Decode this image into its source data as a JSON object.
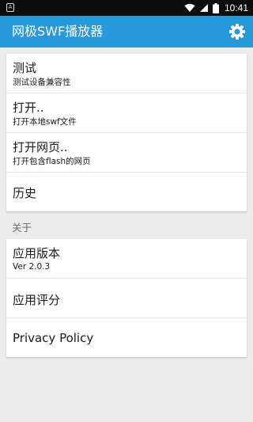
{
  "statusbar": {
    "left_icon": "A",
    "icons": [
      "wifi-icon",
      "signal-icon",
      "battery-icon"
    ],
    "time": "10:41"
  },
  "appbar": {
    "title": "网极SWF播放器",
    "settings_icon": "gear-icon",
    "color": "#2799db"
  },
  "menu": {
    "test": {
      "title": "测试",
      "subtitle": "测试设备兼容性"
    },
    "open": {
      "title": "打开..",
      "subtitle": "打开本地swf文件"
    },
    "open_web": {
      "title": "打开网页..",
      "subtitle": "打开包含flash的网页"
    },
    "history": {
      "title": "历史"
    }
  },
  "about": {
    "section_label": "关于",
    "version": {
      "title": "应用版本",
      "subtitle": "Ver 2.0.3"
    },
    "rate": {
      "title": "应用评分"
    },
    "privacy": {
      "title": "Privacy Policy"
    }
  }
}
